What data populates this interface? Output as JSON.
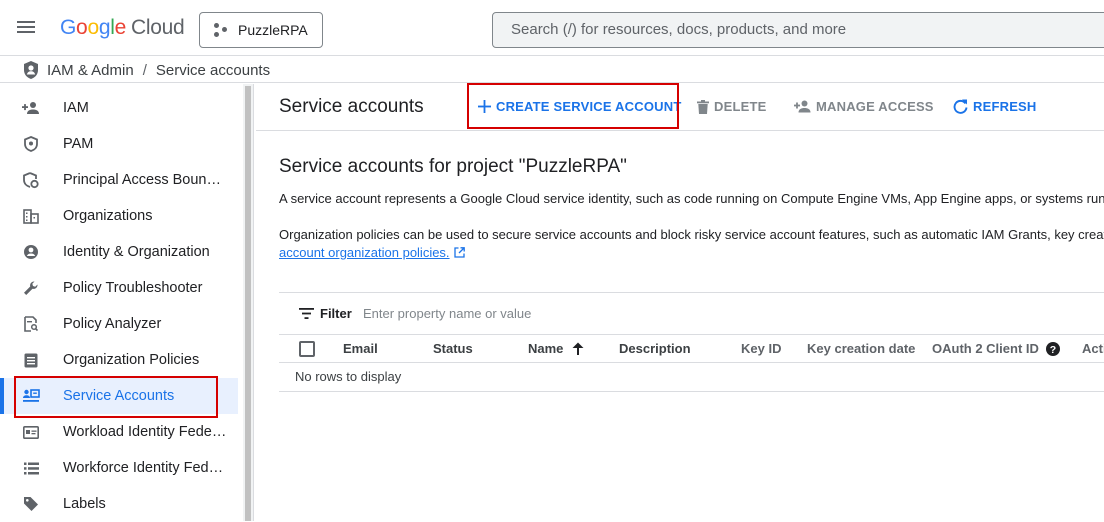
{
  "header": {
    "logo_google": [
      "G",
      "o",
      "o",
      "g",
      "l",
      "e"
    ],
    "logo_cloud": "Cloud",
    "project": "PuzzleRPA",
    "search_placeholder": "Search (/) for resources, docs, products, and more"
  },
  "breadcrumb": {
    "section": "IAM & Admin",
    "separator": "/",
    "page": "Service accounts"
  },
  "sidebar": {
    "items": [
      {
        "label": "IAM",
        "icon": "person-add-icon"
      },
      {
        "label": "PAM",
        "icon": "shield-icon"
      },
      {
        "label": "Principal Access Boun…",
        "icon": "shield-gear-icon"
      },
      {
        "label": "Organizations",
        "icon": "domain-icon"
      },
      {
        "label": "Identity & Organization",
        "icon": "account-circle-icon"
      },
      {
        "label": "Policy Troubleshooter",
        "icon": "wrench-icon"
      },
      {
        "label": "Policy Analyzer",
        "icon": "document-search-icon"
      },
      {
        "label": "Organization Policies",
        "icon": "list-doc-icon"
      },
      {
        "label": "Service Accounts",
        "icon": "service-account-icon",
        "active": true
      },
      {
        "label": "Workload Identity Fede…",
        "icon": "id-card-icon"
      },
      {
        "label": "Workforce Identity Fed…",
        "icon": "list-icon"
      },
      {
        "label": "Labels",
        "icon": "tag-icon"
      }
    ]
  },
  "toolbar": {
    "title": "Service accounts",
    "create": "CREATE SERVICE ACCOUNT",
    "delete": "DELETE",
    "manage": "MANAGE ACCESS",
    "refresh": "REFRESH"
  },
  "content": {
    "heading": "Service accounts for project \"PuzzleRPA\"",
    "desc1": "A service account represents a Google Cloud service identity, such as code running on Compute Engine VMs, App Engine apps, or systems running outside Google.",
    "desc2": "Organization policies can be used to secure service accounts and block risky service account features, such as automatic IAM Grants, key creation/upload, or the creation of service accounts entirely. Learn more about",
    "link": "account organization policies."
  },
  "filter": {
    "label": "Filter",
    "placeholder": "Enter property name or value"
  },
  "table": {
    "columns": [
      "Email",
      "Status",
      "Name",
      "Description",
      "Key ID",
      "Key creation date",
      "OAuth 2 Client ID",
      "Actions"
    ],
    "empty": "No rows to display"
  },
  "colors": {
    "accent": "#1a73e8",
    "highlight": "#d50000"
  }
}
